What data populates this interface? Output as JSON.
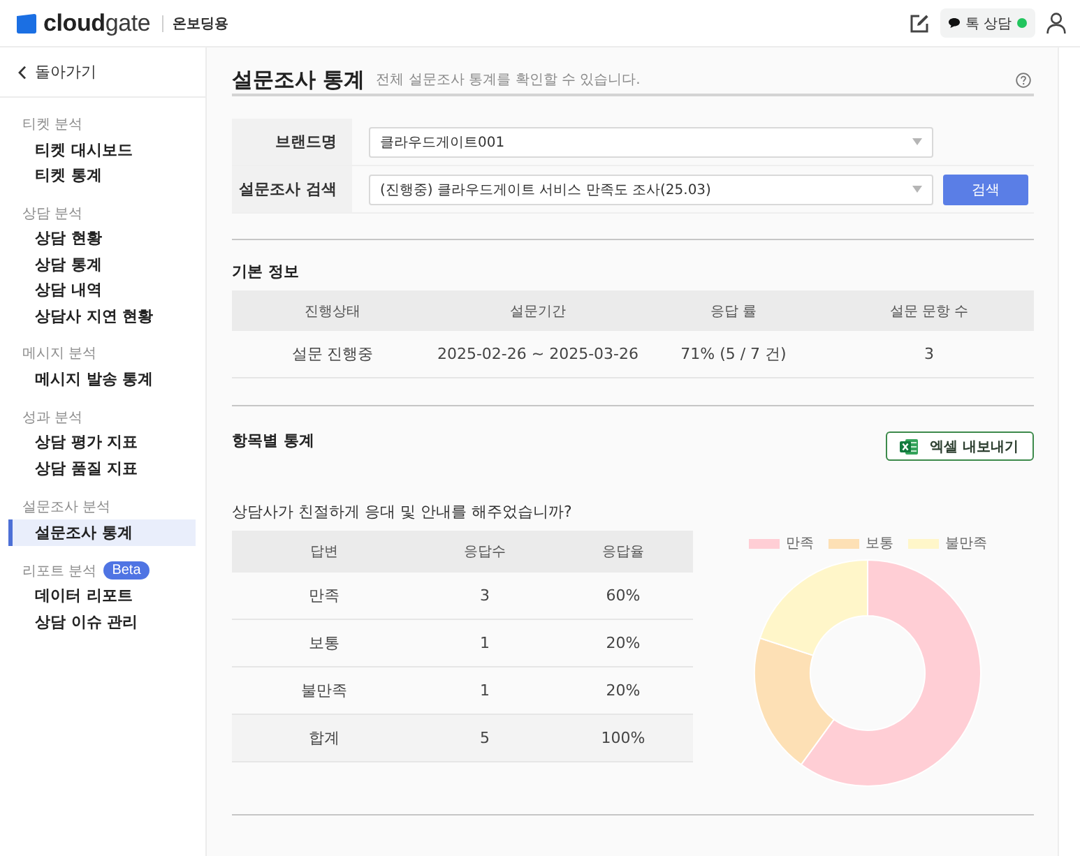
{
  "header": {
    "logo": "**cloud**gate",
    "workspace": "온보딩용",
    "chat_button": {
      "label": "톡 상담",
      "online": true
    }
  },
  "sidebar": {
    "back": "돌아가기",
    "groups": [
      {
        "title": "티켓 분석",
        "items": [
          {
            "label": "티켓 대시보드",
            "selected": false
          },
          {
            "label": "티켓 통계",
            "selected": false
          }
        ]
      },
      {
        "title": "상담 분석",
        "items": [
          {
            "label": "상담 현황",
            "selected": false
          },
          {
            "label": "상담 통계",
            "selected": false
          },
          {
            "label": "상담 내역",
            "selected": false
          },
          {
            "label": "상담사 지연 현황",
            "selected": false
          }
        ]
      },
      {
        "title": "메시지 분석",
        "items": [
          {
            "label": "메시지 발송 통계",
            "selected": false
          }
        ]
      },
      {
        "title": "성과 분석",
        "items": [
          {
            "label": "상담 평가 지표",
            "selected": false
          },
          {
            "label": "상담 품질 지표",
            "selected": false
          }
        ]
      },
      {
        "title": "설문조사 분석",
        "items": [
          {
            "label": "설문조사 통계",
            "selected": true
          }
        ]
      },
      {
        "title": "리포트 분석",
        "badge": "Beta",
        "items": [
          {
            "label": "데이터 리포트",
            "selected": false
          },
          {
            "label": "상담 이슈 관리",
            "selected": false
          }
        ]
      }
    ]
  },
  "page": {
    "title": "설문조사 통계",
    "subtitle": "전체 설문조사 통계를 확인할 수 있습니다."
  },
  "filters": [
    {
      "label": "브랜드명",
      "value": "클라우드게이트001"
    },
    {
      "label": "설문조사 검색",
      "value": "(진행중) 클라우드게이트 서비스 만족도 조사(25.03)",
      "button": "검색"
    }
  ],
  "basic_info": {
    "title": "기본 정보",
    "columns": [
      "진행상태",
      "설문기간",
      "응답 률",
      "설문 문항 수"
    ],
    "rows": [
      [
        "설문 진행중",
        "2025-02-26 ~ 2025-03-26",
        "71% (5 / 7 건)",
        "3"
      ]
    ]
  },
  "item_stats": {
    "title": "항목별 통계",
    "export_button": "엑셀 내보내기",
    "questions": [
      {
        "question": "상담사가 친절하게 응대 및 안내를 해주었습니까?",
        "columns": [
          "답변",
          "응답수",
          "응답율"
        ],
        "rows": [
          {
            "kind": "answer",
            "cells": [
              "만족",
              "3",
              "60%"
            ]
          },
          {
            "kind": "answer",
            "cells": [
              "보통",
              "1",
              "20%"
            ]
          },
          {
            "kind": "answer",
            "cells": [
              "불만족",
              "1",
              "20%"
            ]
          },
          {
            "kind": "total",
            "cells": [
              "합계",
              "5",
              "100%"
            ]
          }
        ],
        "chart_data": {
          "type": "donut",
          "categories": [
            "만족",
            "보통",
            "불만족"
          ],
          "values": [
            60,
            20,
            20
          ],
          "colors": [
            "#ffced5",
            "#fde0b5",
            "#fff6c9"
          ],
          "legend": "top"
        }
      }
    ]
  }
}
